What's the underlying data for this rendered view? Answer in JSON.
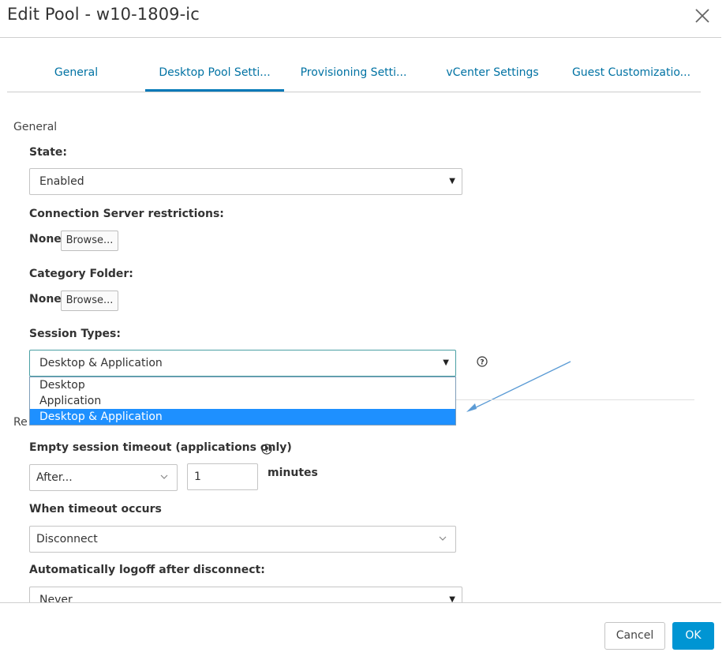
{
  "dialog": {
    "title": "Edit Pool - w10-1809-ic"
  },
  "tabs": [
    {
      "label": "General"
    },
    {
      "label": "Desktop Pool Setti..."
    },
    {
      "label": "Provisioning Setti..."
    },
    {
      "label": "vCenter Settings"
    },
    {
      "label": "Guest Customizatio..."
    }
  ],
  "general": {
    "section_label": "General",
    "state_label": "State:",
    "state_value": "Enabled",
    "conn_server_label": "Connection Server restrictions:",
    "conn_server_value": "None",
    "browse_label": "Browse...",
    "category_label": "Category Folder:",
    "category_value": "None",
    "session_types_label": "Session Types:",
    "session_types_value": "Desktop & Application",
    "session_types_options": [
      "Desktop",
      "Application",
      "Desktop & Application"
    ]
  },
  "remote": {
    "section_label_partial": "Re",
    "empty_timeout_label": "Empty session timeout (applications only)",
    "after_value": "After...",
    "timeout_value": "1",
    "minutes_label": "minutes",
    "when_timeout_label": "When timeout occurs",
    "when_timeout_value": "Disconnect",
    "auto_logoff_label": "Automatically logoff after disconnect:",
    "auto_logoff_value": "Never"
  },
  "footer": {
    "cancel_label": "Cancel",
    "ok_label": "OK"
  },
  "colors": {
    "accent": "#0079b8",
    "tab_text": "#0072a3",
    "ok_button": "#0095d3",
    "selected_option": "#1e90ff",
    "annotation_arrow": "#5b9bd5"
  },
  "icons": {
    "close": "close-icon",
    "help": "help-circle-icon",
    "caret": "caret-down-icon",
    "chevron": "chevron-down-icon"
  }
}
